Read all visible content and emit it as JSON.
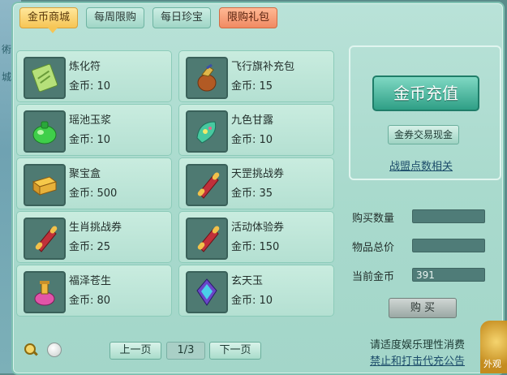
{
  "tabs": [
    {
      "label": "金币商城",
      "active": true
    },
    {
      "label": "每周限购"
    },
    {
      "label": "每日珍宝"
    },
    {
      "label": "限购礼包"
    }
  ],
  "items": [
    {
      "name": "炼化符",
      "price": "金币: 10",
      "icon": "talisman-icon"
    },
    {
      "name": "飞行旗补充包",
      "price": "金币: 15",
      "icon": "flag-pouch-icon"
    },
    {
      "name": "瑶池玉浆",
      "price": "金币: 10",
      "icon": "jade-pot-icon"
    },
    {
      "name": "九色甘露",
      "price": "金币: 10",
      "icon": "dew-gem-icon"
    },
    {
      "name": "聚宝盒",
      "price": "金币: 500",
      "icon": "treasure-box-icon"
    },
    {
      "name": "天罡挑战券",
      "price": "金币: 35",
      "icon": "scroll-icon"
    },
    {
      "name": "生肖挑战券",
      "price": "金币: 25",
      "icon": "scroll-icon"
    },
    {
      "name": "活动体验券",
      "price": "金币: 150",
      "icon": "scroll-icon"
    },
    {
      "name": "福泽苍生",
      "price": "金币: 80",
      "icon": "potion-icon"
    },
    {
      "name": "玄天玉",
      "price": "金币: 10",
      "icon": "dark-jade-icon"
    }
  ],
  "right": {
    "recharge": "金币充值",
    "exchange": "金券交易现金",
    "alliance": "战盟点数相关"
  },
  "form": {
    "quantity_label": "购买数量",
    "quantity_value": "",
    "total_label": "物品总价",
    "total_value": "",
    "current_label": "当前金币",
    "current_value": "391",
    "buy": "购 买"
  },
  "pager": {
    "prev": "上一页",
    "indicator": "1/3",
    "next": "下一页"
  },
  "notice": {
    "line1": "请适度娱乐理性消费",
    "line2": "禁止和打击代充公告"
  },
  "left_strip": {
    "chars": [
      "術",
      "城"
    ]
  },
  "corner_label": "外观"
}
